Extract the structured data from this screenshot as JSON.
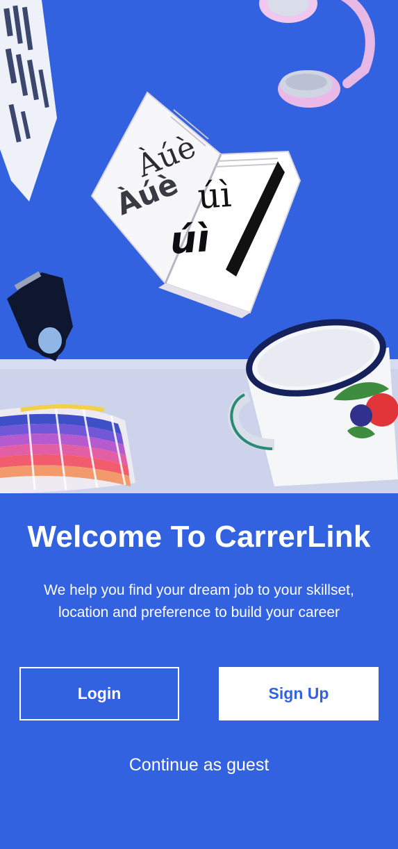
{
  "welcome": {
    "title": "Welcome To CarrerLink",
    "subtitle": "We help you find your dream job to your skillset, location and preference to build your career"
  },
  "actions": {
    "login_label": "Login",
    "signup_label": "Sign Up",
    "guest_label": "Continue as guest"
  },
  "hero": {
    "book_glyphs": [
      "Àúè",
      "úì",
      "Àúè",
      "úì"
    ]
  },
  "colors": {
    "brand": "#3362E1",
    "on_brand": "#FFFFFF"
  }
}
